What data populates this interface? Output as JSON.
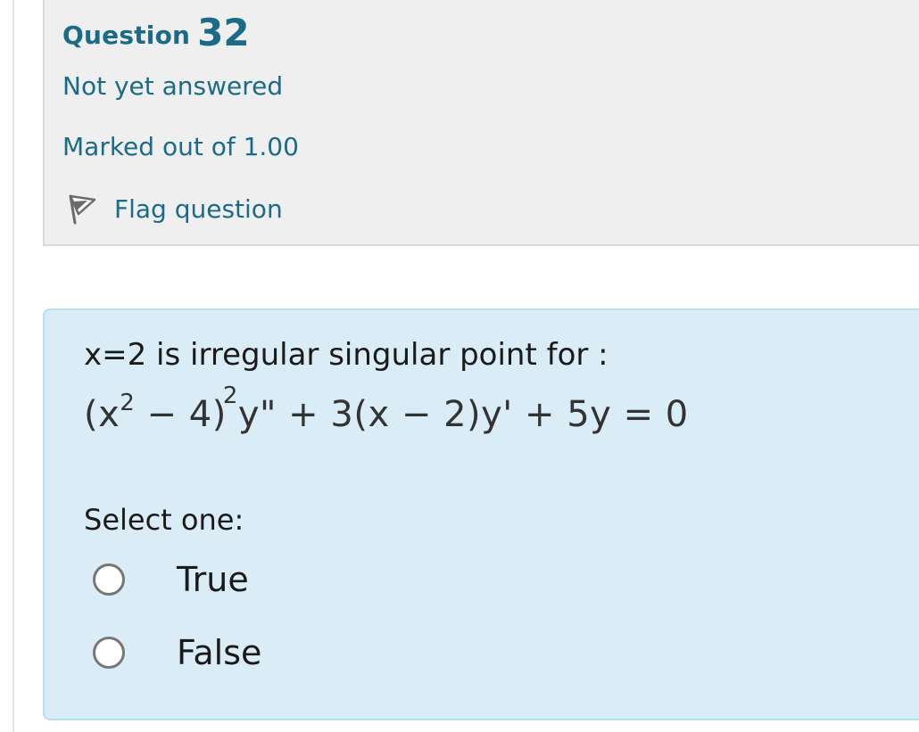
{
  "question_info": {
    "heading_word": "Question",
    "number": "32",
    "state": "Not yet answered",
    "grade": "Marked out of 1.00",
    "flag_label": "Flag question",
    "flag_icon": "flag-icon"
  },
  "question": {
    "text": "x=2 is irregular singular point for :",
    "equation": {
      "part1": "(x",
      "exp1": "2",
      "part2": " − 4)",
      "exp2": "2",
      "part3": "y\" + 3(x − 2)y' + 5y = 0"
    },
    "prompt": "Select one:",
    "options": [
      {
        "label": "True",
        "selected": false
      },
      {
        "label": "False",
        "selected": false
      }
    ]
  },
  "colors": {
    "link": "#1b6b86",
    "info_bg": "#efefef",
    "content_bg": "#daecf6",
    "content_border": "#b8def0"
  }
}
